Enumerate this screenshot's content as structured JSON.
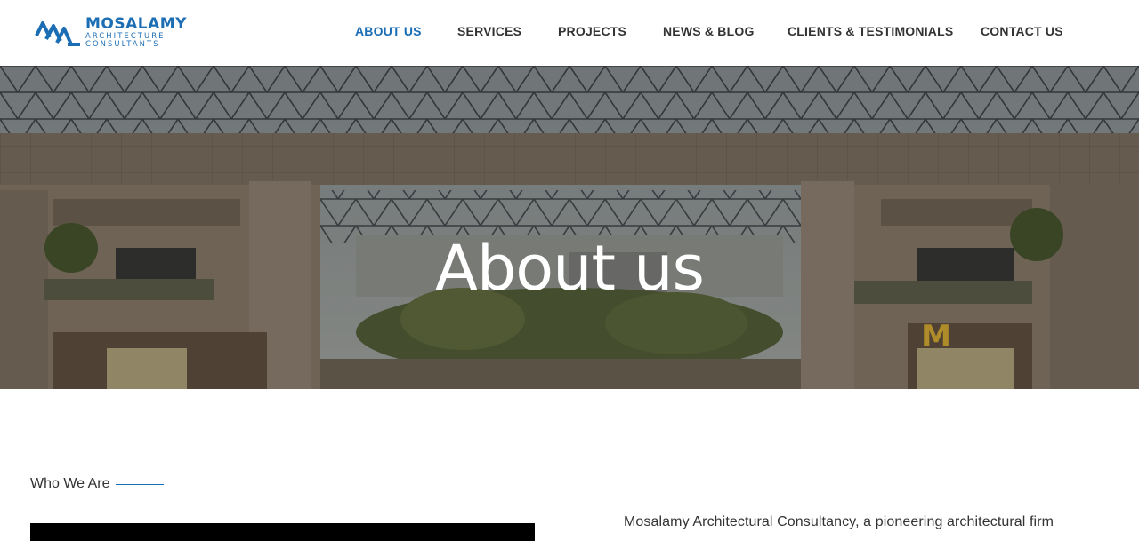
{
  "brand": {
    "name": "MOSALAMY",
    "line1": "ARCHITECTURE",
    "line2": "CONSULTANTS",
    "color": "#1c6eb4"
  },
  "nav": {
    "items": [
      {
        "label": "ABOUT US",
        "active": true
      },
      {
        "label": "SERVICES",
        "active": false
      },
      {
        "label": "PROJECTS",
        "active": false
      },
      {
        "label": "NEWS & BLOG",
        "active": false
      },
      {
        "label": "CLIENTS & TESTIMONIALS",
        "active": false
      },
      {
        "label": "CONTACT US",
        "active": false
      }
    ]
  },
  "hero": {
    "title": "About us"
  },
  "section": {
    "eyebrow": "Who We Are",
    "intro": "Mosalamy Architectural Consultancy, a pioneering architectural firm"
  }
}
